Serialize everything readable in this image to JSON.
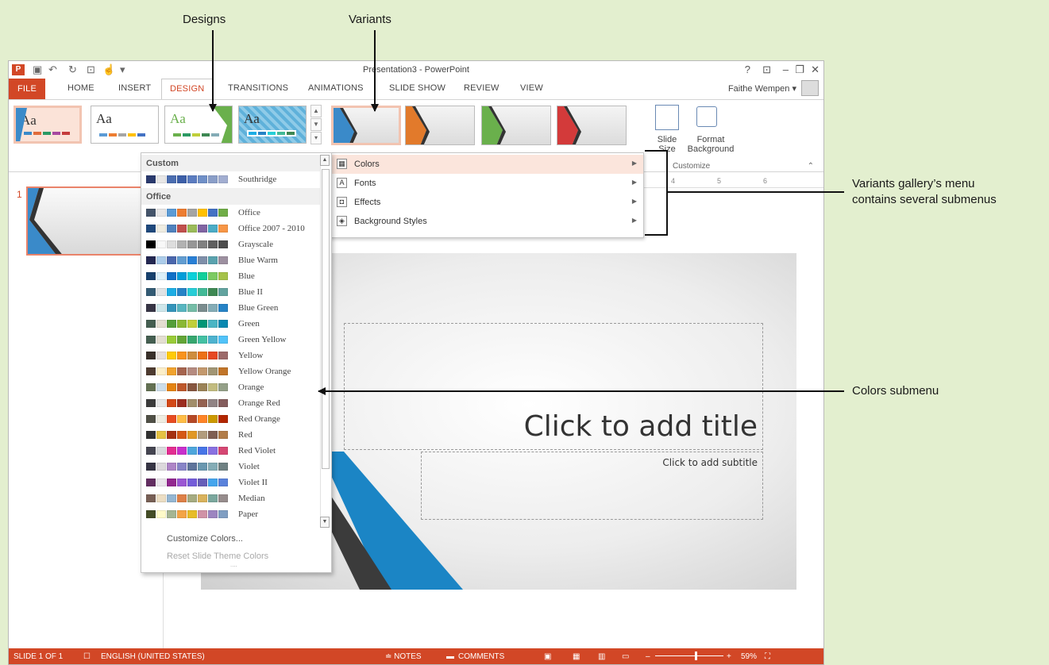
{
  "callouts": {
    "designs": "Designs",
    "variants": "Variants",
    "variants_menu_line1": "Variants gallery’s menu",
    "variants_menu_line2": "contains several submenus",
    "colors_submenu": "Colors submenu"
  },
  "window": {
    "title": "Presentation3 - PowerPoint",
    "help": "?",
    "user_name": "Faithe Wempen",
    "user_arrow": "▾"
  },
  "tabs": {
    "file": "FILE",
    "home": "HOME",
    "insert": "INSERT",
    "design": "DESIGN",
    "transitions": "TRANSITIONS",
    "animations": "ANIMATIONS",
    "slideshow": "SLIDE SHOW",
    "review": "REVIEW",
    "view": "VIEW"
  },
  "ribbon": {
    "theme_sample": "Aa",
    "slide_size_label": "Slide Size",
    "format_background_label1": "Format",
    "format_background_label2": "Background",
    "customize_group": "Customize"
  },
  "slide_pane": {
    "slide_number": "1"
  },
  "ruler": {
    "marks": [
      "4",
      "5",
      "6"
    ]
  },
  "slide": {
    "title_placeholder": "Click to add title",
    "subtitle_placeholder": "Click to add subtitle"
  },
  "variants_menu": {
    "items": [
      {
        "label": "Colors",
        "icon": "colors-icon"
      },
      {
        "label": "Fonts",
        "icon": "fonts-icon"
      },
      {
        "label": "Effects",
        "icon": "effects-icon"
      },
      {
        "label": "Background Styles",
        "icon": "background-styles-icon"
      }
    ]
  },
  "colors_menu": {
    "custom_header": "Custom",
    "office_header": "Office",
    "custom_schemes": [
      {
        "name": "Southridge",
        "colors": [
          "#2a3a6e",
          "#e7e6e6",
          "#4a6db0",
          "#3c5fa8",
          "#5b7cc0",
          "#6f8fc7",
          "#8a9ec8",
          "#a2aed1"
        ]
      }
    ],
    "schemes": [
      {
        "name": "Office",
        "colors": [
          "#44546a",
          "#e7e6e6",
          "#5b9bd5",
          "#ed7d31",
          "#a5a5a5",
          "#ffc000",
          "#4472c4",
          "#70ad47"
        ]
      },
      {
        "name": "Office 2007 - 2010",
        "colors": [
          "#1f497d",
          "#eeece1",
          "#4f81bd",
          "#c0504d",
          "#9bbb59",
          "#8064a2",
          "#4bacc6",
          "#f79646"
        ]
      },
      {
        "name": "Grayscale",
        "colors": [
          "#000000",
          "#f8f8f8",
          "#dddddd",
          "#b2b2b2",
          "#969696",
          "#808080",
          "#5f5f5f",
          "#4d4d4d"
        ]
      },
      {
        "name": "Blue Warm",
        "colors": [
          "#242852",
          "#acccea",
          "#4a66ac",
          "#629dd1",
          "#297fd5",
          "#7f8fa9",
          "#5aa2ae",
          "#9d90a0"
        ]
      },
      {
        "name": "Blue",
        "colors": [
          "#17406d",
          "#dbeff9",
          "#0f6fc6",
          "#009dd9",
          "#0bd0d9",
          "#10cf9b",
          "#7cca62",
          "#a5c249"
        ]
      },
      {
        "name": "Blue II",
        "colors": [
          "#335b74",
          "#dfe3e5",
          "#1cade4",
          "#2683c6",
          "#27ced7",
          "#42ba97",
          "#3e8853",
          "#62a39f"
        ]
      },
      {
        "name": "Blue Green",
        "colors": [
          "#373545",
          "#cee6ea",
          "#3494ba",
          "#58b6c0",
          "#75bda7",
          "#7a8c8e",
          "#84acb6",
          "#2683c6"
        ]
      },
      {
        "name": "Green",
        "colors": [
          "#455f51",
          "#e3ded1",
          "#549e39",
          "#8ab833",
          "#c0cf3a",
          "#029676",
          "#4ab5c4",
          "#0989b1"
        ]
      },
      {
        "name": "Green Yellow",
        "colors": [
          "#455f51",
          "#e3ded1",
          "#99cb38",
          "#63a537",
          "#37a76f",
          "#44c1a3",
          "#4eb3cf",
          "#51c3f9"
        ]
      },
      {
        "name": "Yellow",
        "colors": [
          "#39302a",
          "#e5dedb",
          "#ffca08",
          "#f8931d",
          "#ce8d3e",
          "#ec7016",
          "#e64823",
          "#9c6a6a"
        ]
      },
      {
        "name": "Yellow Orange",
        "colors": [
          "#4e3b30",
          "#fbeec9",
          "#f0a22e",
          "#a5644e",
          "#b58b80",
          "#c3986d",
          "#a19574",
          "#c17529"
        ]
      },
      {
        "name": "Orange",
        "colors": [
          "#637052",
          "#ccddea",
          "#e48312",
          "#bd582c",
          "#865640",
          "#9b8357",
          "#c2bc80",
          "#94a088"
        ]
      },
      {
        "name": "Orange Red",
        "colors": [
          "#3c3c3c",
          "#e6e6e6",
          "#d34817",
          "#9b2d1f",
          "#a28e6a",
          "#956251",
          "#918485",
          "#855d5d"
        ]
      },
      {
        "name": "Red Orange",
        "colors": [
          "#505046",
          "#eeece1",
          "#e84c22",
          "#ffbd47",
          "#b64926",
          "#ff8427",
          "#cc9900",
          "#b22600"
        ]
      },
      {
        "name": "Red",
        "colors": [
          "#323232",
          "#e5c243",
          "#a5300f",
          "#d55816",
          "#e19825",
          "#b19c7d",
          "#7f5f52",
          "#b27d49"
        ]
      },
      {
        "name": "Red Violet",
        "colors": [
          "#454551",
          "#d8d9dc",
          "#e32d91",
          "#c830cc",
          "#4ea6dc",
          "#4775e7",
          "#8971e1",
          "#d54773"
        ]
      },
      {
        "name": "Violet",
        "colors": [
          "#373545",
          "#dcd8dc",
          "#ad84c6",
          "#8784c7",
          "#5d739a",
          "#6997af",
          "#84acb6",
          "#6f8183"
        ]
      },
      {
        "name": "Violet II",
        "colors": [
          "#632e62",
          "#eae5eb",
          "#92278f",
          "#9b57d3",
          "#755dd9",
          "#665eb8",
          "#45a5ed",
          "#5982db"
        ]
      },
      {
        "name": "Median",
        "colors": [
          "#775f55",
          "#ebddc3",
          "#94b6d2",
          "#dd8047",
          "#a5ab81",
          "#d8b25c",
          "#7ba79d",
          "#968c8c"
        ]
      },
      {
        "name": "Paper",
        "colors": [
          "#444d26",
          "#fefac9",
          "#a5b592",
          "#f3a447",
          "#e7bc29",
          "#d092a7",
          "#9c85c0",
          "#809ec2"
        ]
      }
    ],
    "customize_colors": "Customize Colors...",
    "reset_colors": "Reset Slide Theme Colors",
    "grip": "....",
    "scroll_up": "▲",
    "scroll_down": "▼"
  },
  "status_bar": {
    "slide_info": "SLIDE 1 OF 1",
    "language": "ENGLISH (UNITED STATES)",
    "notes": "≐ NOTES",
    "comments": "COMMENTS",
    "zoom": "59%"
  },
  "colors": {
    "accent": "#d24726",
    "callout_bg": "#e3efcf",
    "highlight": "#fbe5dc"
  }
}
